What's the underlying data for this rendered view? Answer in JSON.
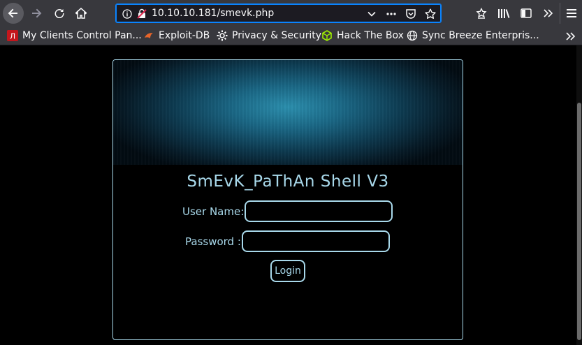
{
  "browser": {
    "url": "10.10.10.181/smevk.php",
    "bookmarks": [
      {
        "label": "My Clients Control Pan...",
        "icon": "cpanel-icon"
      },
      {
        "label": "Exploit-DB",
        "icon": "exploitdb-icon"
      },
      {
        "label": "Privacy & Security",
        "icon": "gear-icon"
      },
      {
        "label": "Hack The Box",
        "icon": "cube-icon"
      },
      {
        "label": "Sync Breeze Enterpris...",
        "icon": "globe-icon"
      }
    ],
    "accent_color": "#0a84ff"
  },
  "page": {
    "title": "SmEvK_PaThAn Shell V3",
    "username_label": "User Name:",
    "password_label": "Password :",
    "username_value": "",
    "password_value": "",
    "login_label": "Login",
    "accent_color": "#a8d8ea"
  }
}
